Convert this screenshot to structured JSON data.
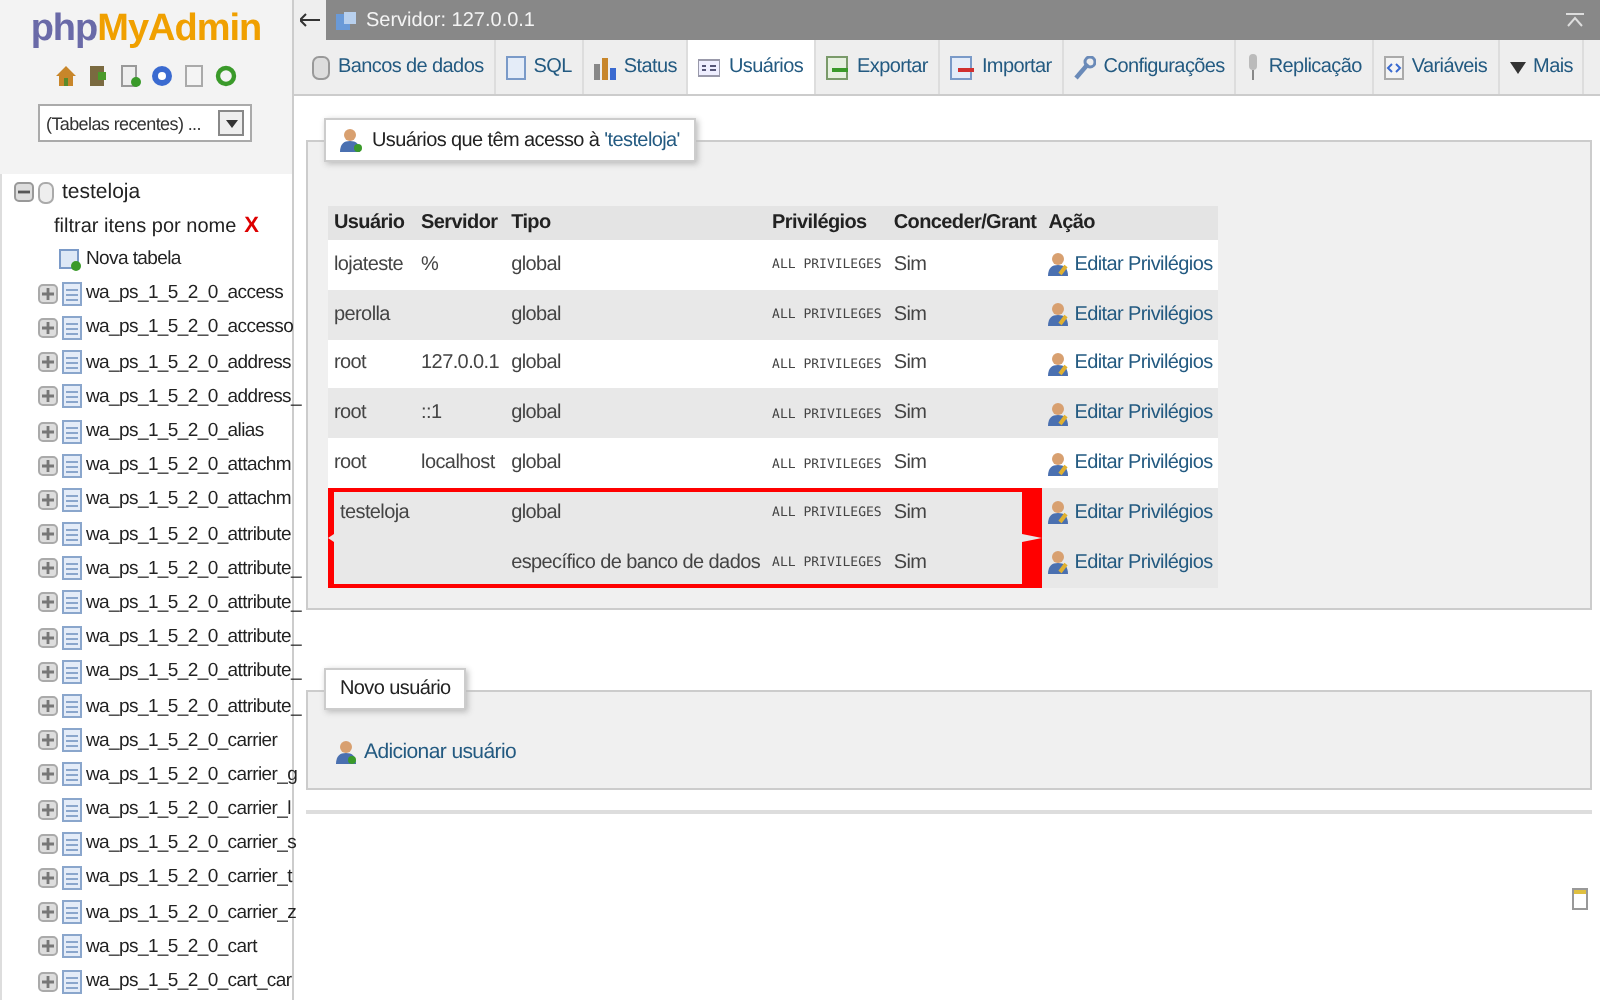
{
  "sidebar": {
    "logo_prefix": "php",
    "logo_name": "MyAdmin",
    "recent_select": "(Tabelas recentes) ...",
    "tree": [
      {
        "label": "testeloja",
        "expanded": true,
        "filter_placeholder": "filtrar itens por nome",
        "filter_clear": "X",
        "new_table": "Nova tabela",
        "children": [
          {
            "label": "wa_ps_1_5_2_0_access"
          },
          {
            "label": "wa_ps_1_5_2_0_accesso"
          },
          {
            "label": "wa_ps_1_5_2_0_address"
          },
          {
            "label": "wa_ps_1_5_2_0_address_"
          },
          {
            "label": "wa_ps_1_5_2_0_alias"
          },
          {
            "label": "wa_ps_1_5_2_0_attachm"
          },
          {
            "label": "wa_ps_1_5_2_0_attachm"
          },
          {
            "label": "wa_ps_1_5_2_0_attribute"
          },
          {
            "label": "wa_ps_1_5_2_0_attribute_"
          },
          {
            "label": "wa_ps_1_5_2_0_attribute_"
          },
          {
            "label": "wa_ps_1_5_2_0_attribute_"
          },
          {
            "label": "wa_ps_1_5_2_0_attribute_"
          },
          {
            "label": "wa_ps_1_5_2_0_attribute_"
          },
          {
            "label": "wa_ps_1_5_2_0_carrier"
          },
          {
            "label": "wa_ps_1_5_2_0_carrier_g"
          },
          {
            "label": "wa_ps_1_5_2_0_carrier_l"
          },
          {
            "label": "wa_ps_1_5_2_0_carrier_s"
          },
          {
            "label": "wa_ps_1_5_2_0_carrier_t"
          },
          {
            "label": "wa_ps_1_5_2_0_carrier_z"
          },
          {
            "label": "wa_ps_1_5_2_0_cart"
          },
          {
            "label": "wa_ps_1_5_2_0_cart_car"
          }
        ]
      }
    ]
  },
  "top_bar": {
    "server": "Servidor: 127.0.0.1"
  },
  "tabs": [
    {
      "label": "Bancos de dados",
      "selected": false
    },
    {
      "label": "SQL",
      "selected": false
    },
    {
      "label": "Status",
      "selected": false
    },
    {
      "label": "Usuários",
      "selected": true
    },
    {
      "label": "Exportar",
      "selected": false
    },
    {
      "label": "Importar",
      "selected": false
    },
    {
      "label": "Configurações",
      "selected": false
    },
    {
      "label": "Replicação",
      "selected": false
    },
    {
      "label": "Variáveis",
      "selected": false
    },
    {
      "label": "Mais",
      "selected": false
    }
  ],
  "users_panel": {
    "legend": "Usuários que têm acesso à ",
    "legend_db": "'testeloja'",
    "columns": [
      "Usuário",
      "Servidor",
      "Tipo",
      "Privilégios",
      "Conceder/Grant",
      "Ação"
    ],
    "users": [
      {
        "user": "lojateste",
        "host": "%",
        "highlighted": false,
        "grants": [
          {
            "type": "global",
            "privileges": "ALL PRIVILEGES",
            "grant": "Sim",
            "action": "Editar Privilégios"
          }
        ]
      },
      {
        "user": "perolla",
        "highlighted": false,
        "grants": [
          {
            "type": "global",
            "privileges": "ALL PRIVILEGES",
            "grant": "Sim",
            "action": "Editar Privilégios"
          }
        ]
      },
      {
        "user": "root",
        "host": "127.0.0.1",
        "highlighted": false,
        "grants": [
          {
            "type": "global",
            "privileges": "ALL PRIVILEGES",
            "grant": "Sim",
            "action": "Editar Privilégios"
          }
        ]
      },
      {
        "user": "root",
        "host": "::1",
        "highlighted": false,
        "grants": [
          {
            "type": "global",
            "privileges": "ALL PRIVILEGES",
            "grant": "Sim",
            "action": "Editar Privilégios"
          }
        ]
      },
      {
        "user": "root",
        "host": "localhost",
        "highlighted": false,
        "grants": [
          {
            "type": "global",
            "privileges": "ALL PRIVILEGES",
            "grant": "Sim",
            "action": "Editar Privilégios"
          }
        ]
      },
      {
        "user": "testeloja",
        "highlighted": true,
        "grants": [
          {
            "type": "global",
            "privileges": "ALL PRIVILEGES",
            "grant": "Sim",
            "action": "Editar Privilégios"
          },
          {
            "type": "específico de banco de dados",
            "privileges": "ALL PRIVILEGES",
            "grant": "Sim",
            "action": "Editar Privilégios"
          }
        ]
      }
    ]
  },
  "new_user_panel": {
    "legend": "Novo usuário",
    "link": "Adicionar usuário"
  }
}
